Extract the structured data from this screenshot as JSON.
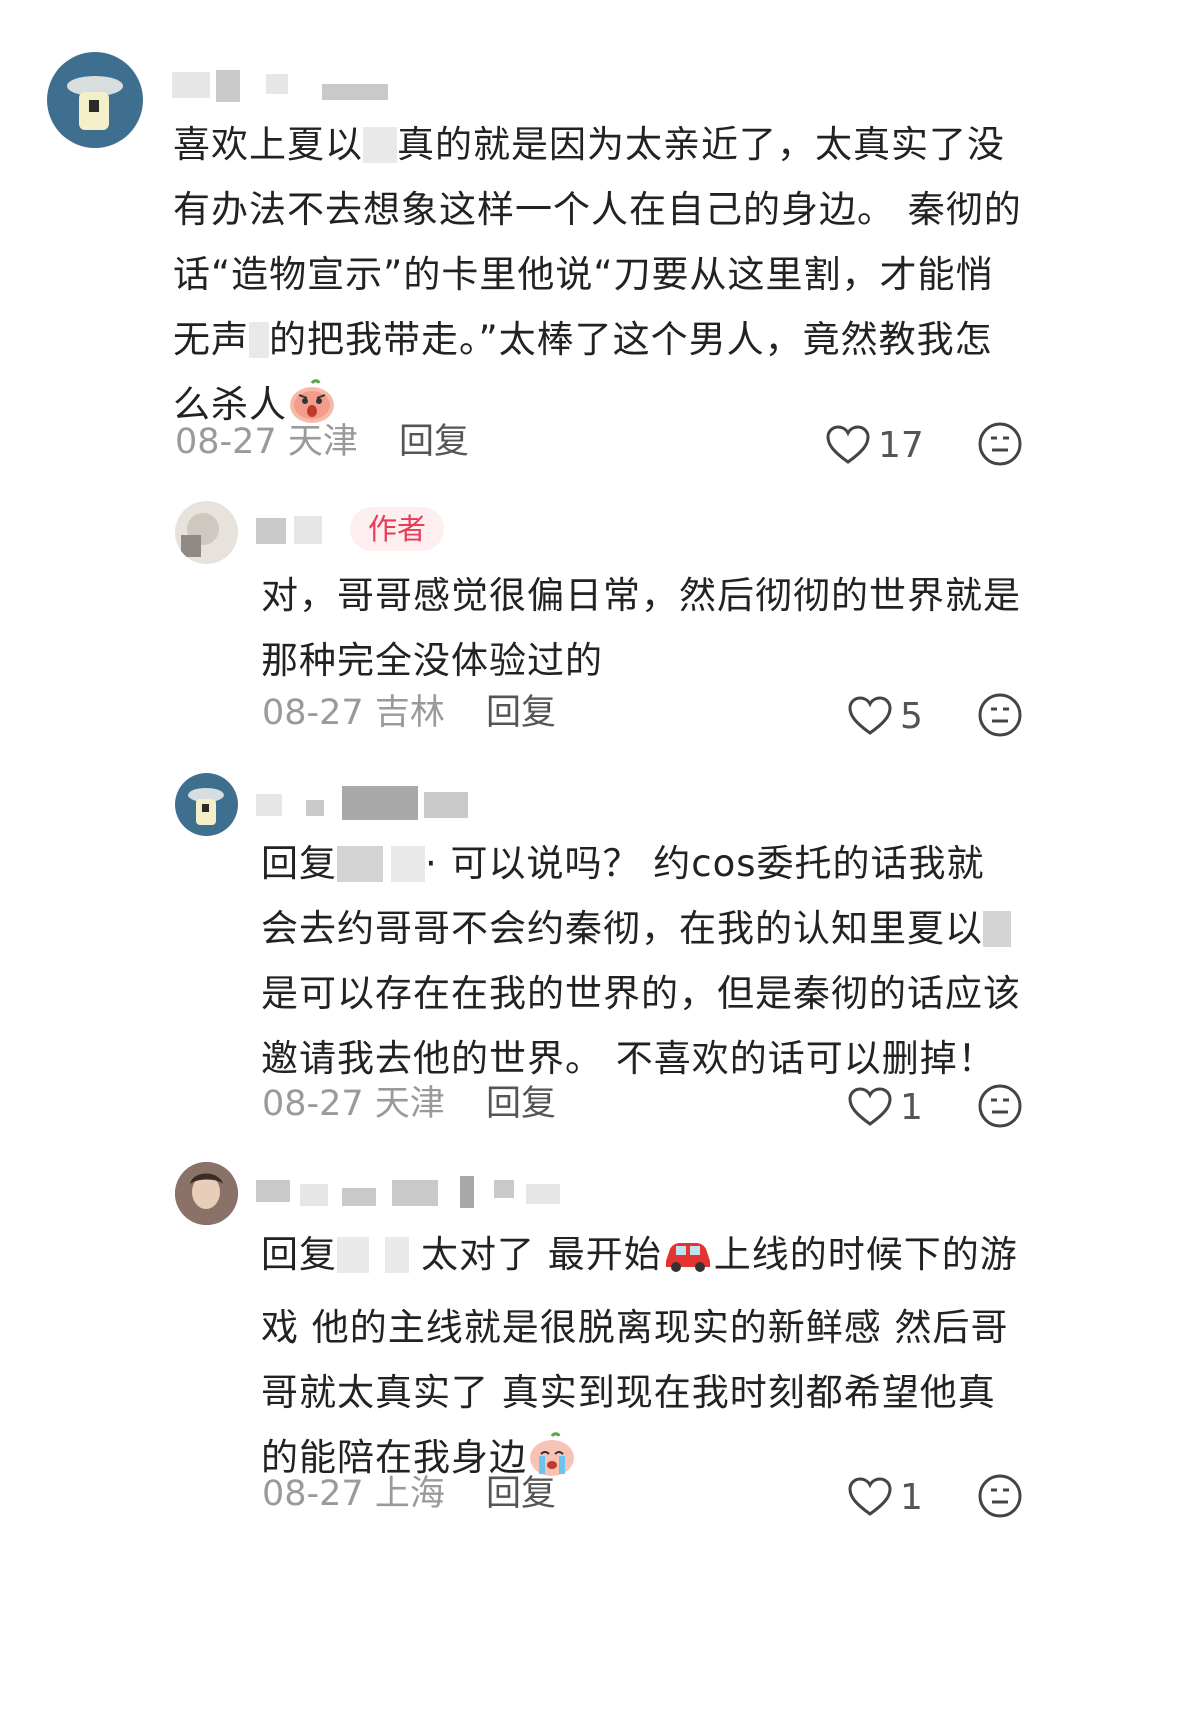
{
  "comments": [
    {
      "text_parts": [
        "喜欢上夏以",
        "真的就是因为太亲近了，太真实了没有办法不去想象这样一个人在自己的身边。 秦彻的话“造物宣示”的卡里他说“刀要从这里割，才能悄无声",
        "的把我带走。”太棒了这个男人，竟然教我怎么杀人"
      ],
      "emoji": "angry-peach-emoji",
      "date": "08-27",
      "location": "天津",
      "reply_label": "回复",
      "likes": "17"
    },
    {
      "author_badge": "作者",
      "text": "对，哥哥感觉很偏日常，然后彻彻的世界就是那种完全没体验过的",
      "date": "08-27",
      "location": "吉林",
      "reply_label": "回复",
      "likes": "5"
    },
    {
      "text_parts": [
        "回复",
        "· 可以说吗？ 约cos委托的话我就会去约哥哥不会约秦彻，在我的认知里夏以",
        "是可以存在在我的世界的，但是秦彻的话应该邀请我去他的世界。 不喜欢的话可以删掉！"
      ],
      "date": "08-27",
      "location": "天津",
      "reply_label": "回复",
      "likes": "1"
    },
    {
      "text_parts": [
        "回复",
        "太对了 最开始",
        "上线的时候下的游戏 他的主线就是很脱离现实的新鲜感 然后哥哥就太真实了 真实到现在我时刻都希望他真的能陪在我身边"
      ],
      "car_emoji": "red-car-emoji",
      "emoji": "crying-peach-emoji",
      "date": "08-27",
      "location": "上海",
      "reply_label": "回复",
      "likes": "1"
    }
  ],
  "colors": {
    "author_badge_bg": "#fdeef0",
    "author_badge_text": "#ea3a55",
    "meta_gray": "#9a9a9a"
  }
}
